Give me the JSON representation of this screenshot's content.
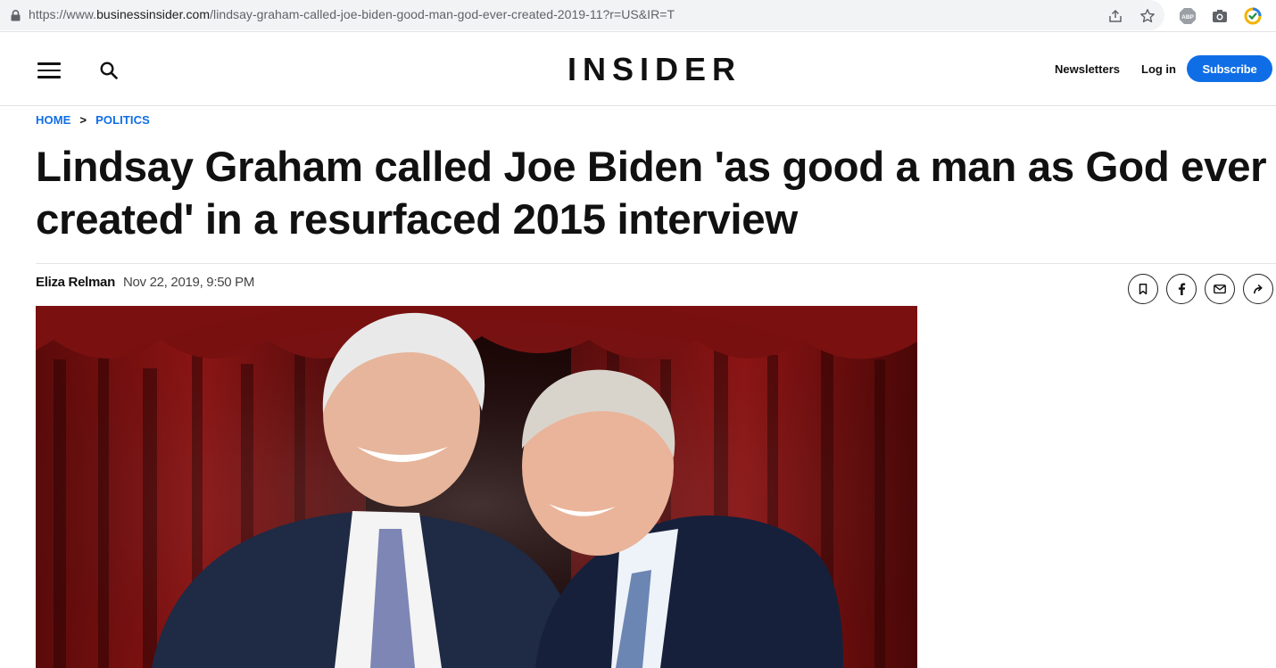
{
  "browser": {
    "url_prefix": "https://www.",
    "url_host": "businessinsider.com",
    "url_path": "/lindsay-graham-called-joe-biden-good-man-god-ever-created-2019-11?r=US&IR=T",
    "icons": [
      "lock-icon",
      "share-page-icon",
      "bookmark-star-icon",
      "adblock-icon",
      "camera-icon",
      "extension-icon"
    ]
  },
  "header": {
    "logo": "INSIDER",
    "newsletters": "Newsletters",
    "login": "Log in",
    "subscribe": "Subscribe",
    "accent": "#0f6ee6"
  },
  "breadcrumb": {
    "home": "HOME",
    "separator": ">",
    "section": "POLITICS"
  },
  "article": {
    "headline": "Lindsay Graham called Joe Biden 'as good a man as God ever created' in a resurfaced 2015 interview",
    "author": "Eliza Relman",
    "date": "Nov 22, 2019, 9:50 PM",
    "share_icons": [
      "bookmark-icon",
      "facebook-icon",
      "email-icon",
      "share-arrow-icon"
    ]
  }
}
